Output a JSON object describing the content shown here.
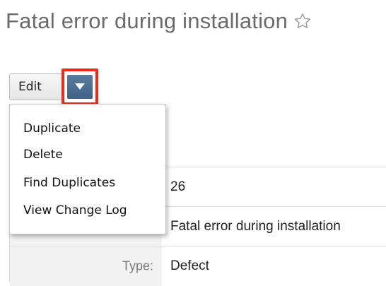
{
  "page": {
    "title": "Fatal error during installation",
    "favorite_icon": "star-outline-icon"
  },
  "actions": {
    "edit_label": "Edit",
    "dropdown_icon": "caret-down-icon",
    "highlight_color": "#ee2b1c",
    "menu_items": [
      {
        "label": "Duplicate"
      },
      {
        "label": "Delete"
      },
      {
        "label": "Find Duplicates"
      },
      {
        "label": "View Change Log"
      }
    ]
  },
  "details": {
    "rows": [
      {
        "label": "",
        "value": "26"
      },
      {
        "label": "",
        "value": "Fatal error during installation"
      },
      {
        "label": "Type:",
        "value": "Defect"
      }
    ]
  }
}
